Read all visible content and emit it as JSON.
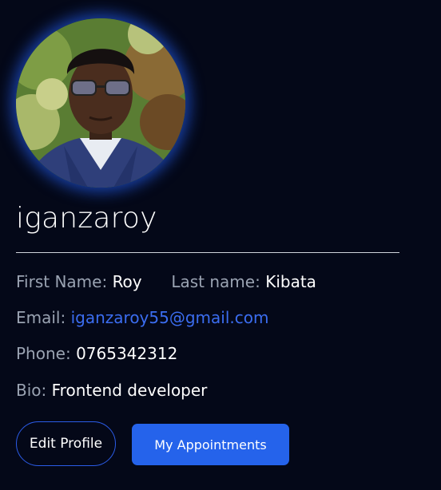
{
  "profile": {
    "username": "iganzaroy",
    "avatar_icon": "user-photo",
    "first_name_label": "First Name:",
    "first_name": "Roy",
    "last_name_label": "Last name:",
    "last_name": "Kibata",
    "email_label": "Email:",
    "email": "iganzaroy55@gmail.com",
    "phone_label": "Phone:",
    "phone": "0765342312",
    "bio_label": "Bio:",
    "bio": "Frontend developer"
  },
  "actions": {
    "edit_label": "Edit Profile",
    "appointments_label": "My Appointments"
  },
  "colors": {
    "background": "#040818",
    "accent": "#2563eb",
    "link": "#3b6df0",
    "label": "#9aa3b2"
  }
}
